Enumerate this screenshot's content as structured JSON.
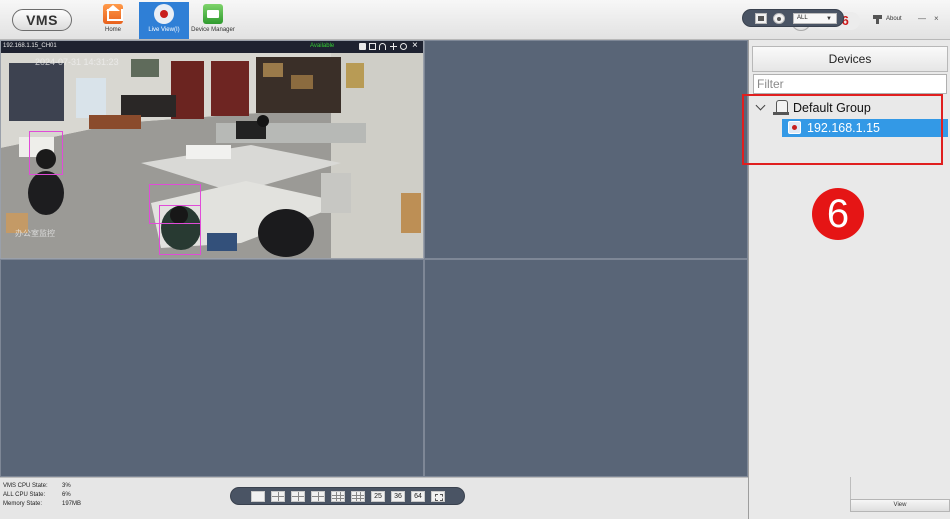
{
  "app": {
    "logo": "VMS"
  },
  "nav": {
    "home": "Home",
    "live_view": "Live View(I)",
    "device_manager": "Device Manager"
  },
  "header": {
    "alarm_count": "136",
    "about": "About",
    "minimize": "—",
    "close": "×"
  },
  "video": {
    "tile1": {
      "channel": "192.168.1.15_CH01",
      "status": "Available",
      "close": "×",
      "osd_time": "2024-07-31 14:31:23",
      "osd_watermark": "办公室监控"
    }
  },
  "devices_panel": {
    "title": "Devices",
    "filter_placeholder": "Filter",
    "group_name": "Default Group",
    "device_name": "192.168.1.15",
    "step_badge": "6",
    "view_button": "View"
  },
  "status": {
    "vms_cpu_label": "VMS CPU State:",
    "vms_cpu_value": "3%",
    "all_cpu_label": "ALL CPU State:",
    "all_cpu_value": "6%",
    "memory_label": "Memory State:",
    "memory_value": "197MB"
  },
  "layout_toolbar": {
    "layout_25": "25",
    "layout_36": "36",
    "layout_64": "64"
  },
  "stream_select": {
    "value": "ALL",
    "arrow": "▼"
  },
  "colors": {
    "accent_blue": "#3399e6",
    "video_bg": "#596577",
    "alarm_red": "#d01b1b",
    "highlight_red": "#e01f1f"
  }
}
